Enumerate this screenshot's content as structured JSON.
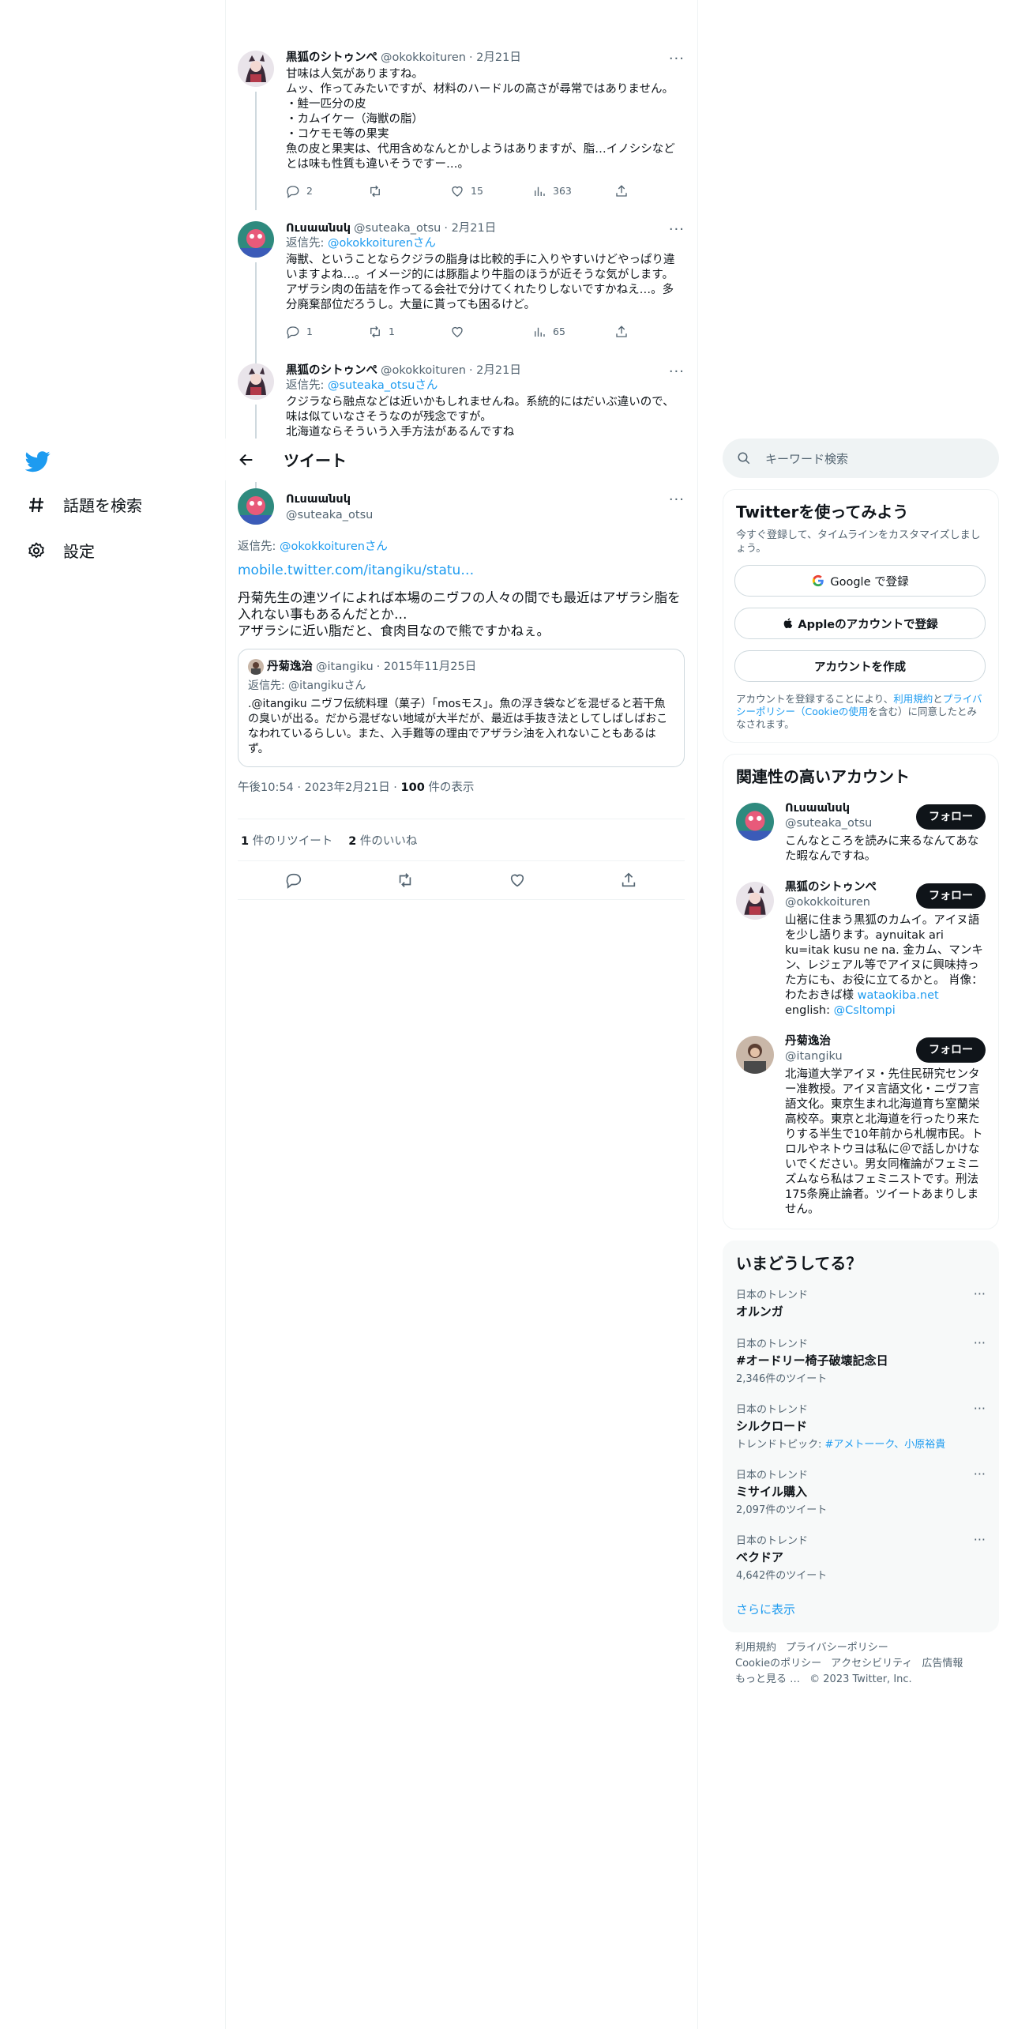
{
  "nav": {
    "logo": "twitter-bird-icon",
    "items": [
      {
        "label": "話題を検索",
        "icon": "hashtag-icon"
      },
      {
        "label": "設定",
        "icon": "gear-icon"
      }
    ]
  },
  "header": {
    "title": "ツイート"
  },
  "thread": [
    {
      "name": "黒狐のシトゥンぺ",
      "handle": "@okokkoituren",
      "date": "· 2月21日",
      "text": "甘味は人気がありますね。\nムッ、作ってみたいですが、材料のハードルの高さが尋常ではありません。\n・鮭一匹分の皮\n・カムイケー（海獣の脂）\n・コケモモ等の果実\n魚の皮と果実は、代用含めなんとかしようはありますが、脂…イノシシなどとは味も性質も違いそうですー…。",
      "replies": "2",
      "retweets": "",
      "likes": "15",
      "views": "363"
    },
    {
      "name": "Ուսաանսկ",
      "handle": "@suteaka_otsu",
      "date": "· 2月21日",
      "reply_prefix": "返信先: ",
      "reply_to": "@okokkoiturenさん",
      "text": "海獣、ということならクジラの脂身は比較的手に入りやすいけどやっぱり違いますよね…。イメージ的には豚脂より牛脂のほうが近そうな気がします。アザラシ肉の缶詰を作ってる会社で分けてくれたりしないですかねえ…。多分廃棄部位だろうし。大量に貰っても困るけど。",
      "replies": "1",
      "retweets": "1",
      "likes": "",
      "views": "65"
    },
    {
      "name": "黒狐のシトゥンぺ",
      "handle": "@okokkoituren",
      "date": "· 2月21日",
      "reply_prefix": "返信先: ",
      "reply_to": "@suteaka_otsuさん",
      "text": "クジラなら融点などは近いかもしれませんね。系統的にはだいぶ違いので、味は似ていなさそうなのが残念ですが。\n北海道ならそういう入手方法があるんですね"
    }
  ],
  "focus": {
    "name": "Ուսաանսկ",
    "handle": "@suteaka_otsu",
    "reply_prefix": "返信先: ",
    "reply_to": "@okokkoiturenさん",
    "link": "mobile.twitter.com/itangiku/statu…",
    "text": "丹菊先生の連ツイによれば本場のニヴフの人々の間でも最近はアザラシ脂を入れない事もあるんだとか…\nアザラシに近い脂だと、食肉目なので熊ですかねぇ。",
    "quote": {
      "name": "丹菊逸治",
      "handle": "@itangiku",
      "date": "· 2015年11月25日",
      "reply": "返信先: @itangikuさん",
      "text": ".@itangiku ニヴフ伝統料理（菓子）「mosモス」。魚の浮き袋などを混ぜると若干魚の臭いが出る。だから混ぜない地域が大半だが、最近は手抜き法としてしばしばおこなわれているらしい。また、入手難等の理由でアザラシ油を入れないこともあるはず。"
    },
    "meta_time": "午後10:54 · 2023年2月21日 · ",
    "meta_views": "100",
    "meta_views_label": " 件の表示",
    "retweet_count": "1",
    "retweet_label": " 件のリツイート",
    "like_count": "2",
    "like_label": " 件のいいね"
  },
  "sidebar": {
    "search_placeholder": "キーワード検索",
    "signup": {
      "title": "Twitterを使ってみよう",
      "desc": "今すぐ登録して、タイムラインをカスタマイズしましょう。",
      "google": "Google で登録",
      "apple": "Appleのアカウントで登録",
      "create": "アカウントを作成",
      "terms_a": "アカウントを登録することにより、",
      "terms_b": "利用規約",
      "terms_c": "と",
      "terms_d": "プライバシーポリシー（Cookieの使用",
      "terms_e": "を含む）に同意したとみなされます。"
    },
    "related": {
      "title": "関連性の高いアカウント",
      "follow_label": "フォロー",
      "accounts": [
        {
          "name": "Ուսաանսկ",
          "handle": "@suteaka_otsu",
          "bio": "こんなところを読みに来るなんてあなた暇なんですね。"
        },
        {
          "name": "黒狐のシトゥンぺ",
          "handle": "@okokkoituren",
          "bio": "山裾に住まう黒狐のカムイ。アイヌ語を少し語ります。aynuitak ari ku=itak kusu ne na. 金カム、マンキン、レジェアル等でアイヌに興味持った方にも、お役に立てるかと。 肖像：わたおきば様 ",
          "bio_link": "wataokiba.net",
          "bio_tail": " english: ",
          "bio_link2": "@Csltompi"
        },
        {
          "name": "丹菊逸治",
          "handle": "@itangiku",
          "bio": "北海道大学アイヌ・先住民研究センター准教授。アイヌ言語文化・ニヴフ言語文化。東京生まれ北海道育ち室蘭栄高校卒。東京と北海道を行ったり来たりする半生で10年前から札幌市民。トロルやネトウヨは私に＠で話しかけないでください。男女同権論がフェミニズムなら私はフェミニストです。刑法175条廃止論者。ツイートあまりしません。"
        }
      ]
    },
    "trends": {
      "title": "いまどうしてる？",
      "items": [
        {
          "context": "日本のトレンド",
          "name": "オルンガ",
          "count": ""
        },
        {
          "context": "日本のトレンド",
          "name": "#オードリー椅子破壊記念日",
          "count": "2,346件のツイート"
        },
        {
          "context": "日本のトレンド",
          "name": "シルクロード",
          "count": "トレンドトピック: ",
          "topic": "#アメトーーク、小原裕貴"
        },
        {
          "context": "日本のトレンド",
          "name": "ミサイル購入",
          "count": "2,097件のツイート"
        },
        {
          "context": "日本のトレンド",
          "name": "ベクドア",
          "count": "4,642件のツイート"
        }
      ],
      "show_more": "さらに表示"
    },
    "footer": {
      "links": [
        "利用規約",
        "プライバシーポリシー",
        "Cookieのポリシー",
        "アクセシビリティ",
        "広告情報",
        "もっと見る …"
      ],
      "copyright": "© 2023 Twitter, Inc."
    }
  },
  "colors": {
    "accent": "#1d9bf0",
    "text": "#0f1419",
    "muted": "#536471"
  }
}
